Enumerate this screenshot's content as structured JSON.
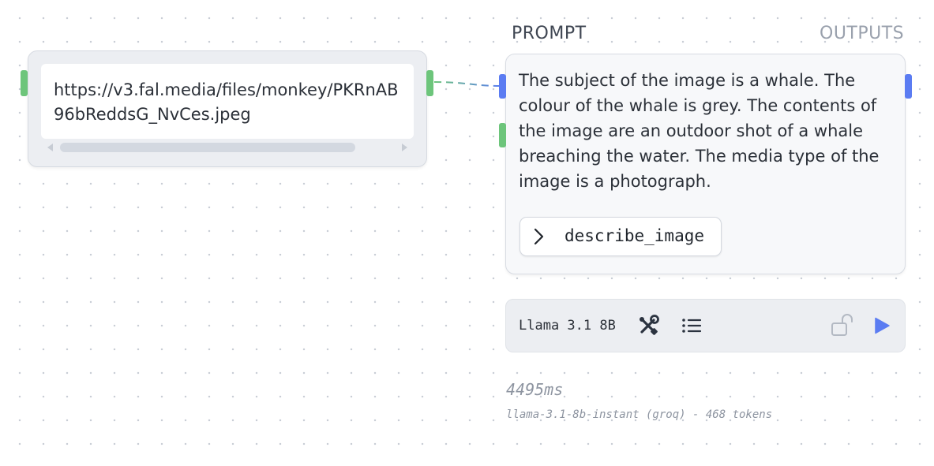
{
  "url_node": {
    "value": "https://v3.fal.media/files/monkey/PKRnAB96bReddsG_NvCes.jpeg"
  },
  "prompt_node": {
    "label": "PROMPT",
    "outputs_label": "OUTPUTS",
    "text": "The subject of the image is a whale. The colour of the whale is grey. The contents of the image are an outdoor shot of a whale breaching the water. The media type of the image is a photograph.",
    "tool_chip": {
      "label": "describe_image",
      "icon": "chevron-right-icon"
    }
  },
  "toolbar": {
    "model": "Llama 3.1 8B",
    "icons": [
      "tools-icon",
      "list-icon",
      "unlock-icon",
      "play-icon"
    ],
    "accent_color": "#5b7cf2"
  },
  "result": {
    "duration": "4495ms",
    "meta": "llama-3.1-8b-instant (groq) - 468 tokens"
  },
  "colors": {
    "input_handle": "#6dc57b",
    "output_handle": "#5b7cf2",
    "canvas_dots": "#c9ced6"
  }
}
